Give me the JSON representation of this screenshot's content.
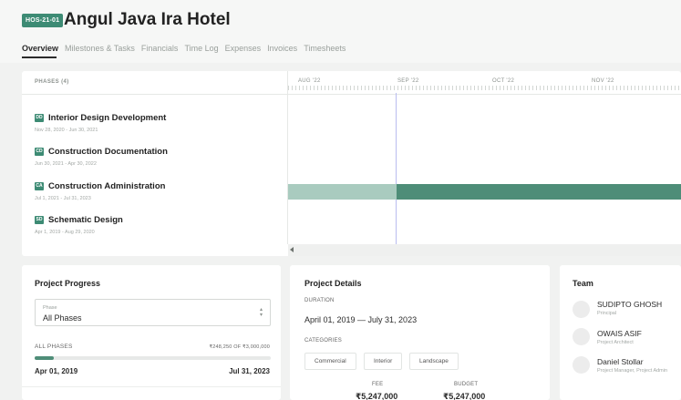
{
  "project": {
    "code": "HOS-21-01",
    "title": "Angul Java Ira Hotel"
  },
  "tabs": [
    "Overview",
    "Milestones & Tasks",
    "Financials",
    "Time Log",
    "Expenses",
    "Invoices",
    "Timesheets"
  ],
  "timeline": {
    "phases_header": "PHASES (4)",
    "months": [
      "AUG '22",
      "SEP '22",
      "OCT '22",
      "NOV '22"
    ],
    "phases": [
      {
        "badge": "DD",
        "name": "Interior Design Development",
        "dates": "Nov 28, 2020 - Jun 30, 2021"
      },
      {
        "badge": "CD",
        "name": "Construction Documentation",
        "dates": "Jun 30, 2021 - Apr 30, 2022"
      },
      {
        "badge": "CA",
        "name": "Construction Administration",
        "dates": "Jul 1, 2021 - Jul 31, 2023"
      },
      {
        "badge": "SD",
        "name": "Schematic Design",
        "dates": "Apr 1, 2019 - Aug 29, 2020"
      }
    ]
  },
  "progress": {
    "title": "Project Progress",
    "select_label": "Phase",
    "select_value": "All Phases",
    "all_phases_label": "ALL PHASES",
    "amount": "₹248,250 OF ₹3,000,000",
    "fraction": 0.083,
    "start_date": "Apr 01, 2019",
    "end_date": "Jul 31, 2023"
  },
  "details": {
    "title": "Project Details",
    "duration_label": "DURATION",
    "duration_value": "April 01, 2019 — July 31, 2023",
    "categories_label": "CATEGORIES",
    "categories": [
      "Commercial",
      "Interior",
      "Landscape"
    ],
    "fee_label": "FEE",
    "fee_value": "₹5,247,000",
    "budget_label": "BUDGET",
    "budget_value": "₹5,247,000"
  },
  "team": {
    "title": "Team",
    "members": [
      {
        "name": "SUDIPTO GHOSH",
        "role": "Principal"
      },
      {
        "name": "OWAIS ASIF",
        "role": "Project Architect"
      },
      {
        "name": "Daniel Stollar",
        "role": "Project Manager, Project Admin"
      }
    ]
  },
  "colors": {
    "accent": "#3d8b74",
    "bar_main": "#4e8d78",
    "bar_light": "#a9cbbf",
    "today_line": "#b9bdf0"
  }
}
